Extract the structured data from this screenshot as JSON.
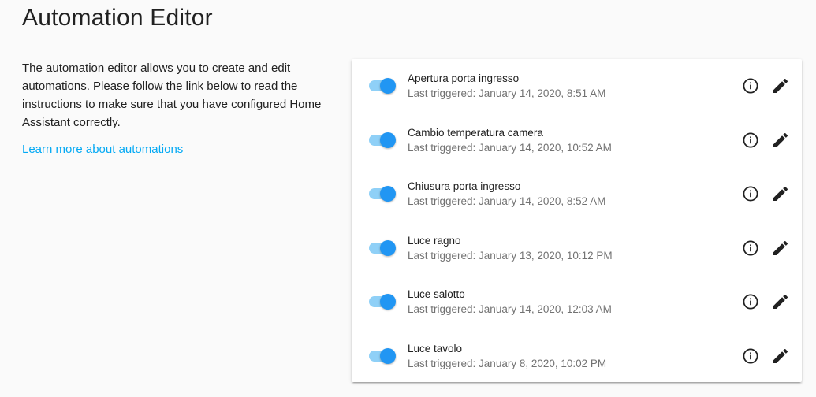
{
  "header": {
    "title": "Automation Editor"
  },
  "intro": {
    "text": "The automation editor allows you to create and edit automations. Please follow the link below to read the instructions to make sure that you have configured Home Assistant correctly.",
    "link_label": "Learn more about automations"
  },
  "colors": {
    "accent": "#2196f3",
    "link": "#03a9f4",
    "toggle_track": "#8fd0f7",
    "secondary_text": "#727272"
  },
  "automations": [
    {
      "name": "Apertura porta ingresso",
      "last_triggered": "Last triggered: January 14, 2020, 8:51 AM",
      "enabled": true,
      "info_icon": "info-outline-icon",
      "edit_icon": "pencil-icon"
    },
    {
      "name": "Cambio temperatura camera",
      "last_triggered": "Last triggered: January 14, 2020, 10:52 AM",
      "enabled": true,
      "info_icon": "info-outline-icon",
      "edit_icon": "pencil-icon"
    },
    {
      "name": "Chiusura porta ingresso",
      "last_triggered": "Last triggered: January 14, 2020, 8:52 AM",
      "enabled": true,
      "info_icon": "info-outline-icon",
      "edit_icon": "pencil-icon"
    },
    {
      "name": "Luce ragno",
      "last_triggered": "Last triggered: January 13, 2020, 10:12 PM",
      "enabled": true,
      "info_icon": "info-outline-icon",
      "edit_icon": "pencil-icon"
    },
    {
      "name": "Luce salotto",
      "last_triggered": "Last triggered: January 14, 2020, 12:03 AM",
      "enabled": true,
      "info_icon": "info-outline-icon",
      "edit_icon": "pencil-icon"
    },
    {
      "name": "Luce tavolo",
      "last_triggered": "Last triggered: January 8, 2020, 10:02 PM",
      "enabled": true,
      "info_icon": "info-outline-icon",
      "edit_icon": "pencil-icon"
    }
  ]
}
